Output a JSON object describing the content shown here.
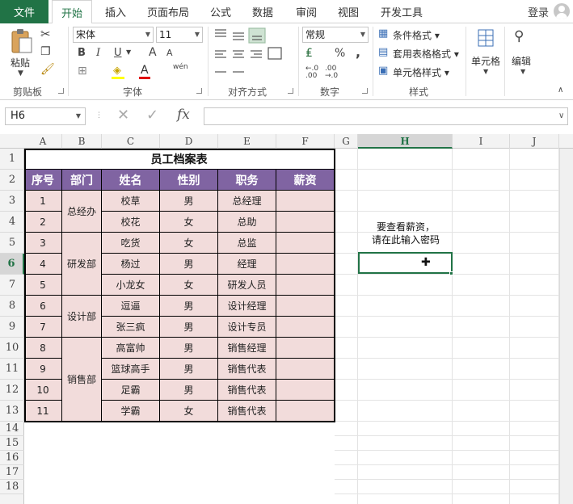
{
  "tabs": {
    "file": "文件",
    "items": [
      "开始",
      "插入",
      "页面布局",
      "公式",
      "数据",
      "审阅",
      "视图",
      "开发工具"
    ],
    "login": "登录"
  },
  "ribbon": {
    "clipboard": {
      "paste": "粘贴",
      "label": "剪贴板"
    },
    "font": {
      "name": "宋体",
      "size": "11",
      "label": "字体",
      "bold": "B",
      "italic": "I",
      "underline": "U",
      "grow": "A",
      "shrink": "A",
      "wen": "wén",
      "font_color": "A"
    },
    "alignment": {
      "label": "对齐方式"
    },
    "number": {
      "format": "常规",
      "label": "数字",
      "percent": "%",
      "comma": ","
    },
    "styles": {
      "conditional": "条件格式",
      "table": "套用表格格式",
      "cell_style": "单元格样式",
      "label": "样式"
    },
    "cells": {
      "label": "单元格"
    },
    "editing": {
      "label": "编辑"
    }
  },
  "formula_bar": {
    "name_box": "H6",
    "fx": "fx",
    "value": ""
  },
  "columns": [
    "A",
    "B",
    "C",
    "D",
    "E",
    "F",
    "G",
    "H",
    "I",
    "J"
  ],
  "active_column": "H",
  "rows": [
    "1",
    "2",
    "3",
    "4",
    "5",
    "6",
    "7",
    "8",
    "9",
    "10",
    "11",
    "12",
    "13",
    "14",
    "15",
    "16",
    "17",
    "18"
  ],
  "active_row": "6",
  "table": {
    "title": "员工档案表",
    "headers": [
      "序号",
      "部门",
      "姓名",
      "性别",
      "职务",
      "薪资"
    ],
    "departments": [
      "总经办",
      "研发部",
      "设计部",
      "销售部"
    ],
    "records": [
      {
        "id": "1",
        "name": "校草",
        "gender": "男",
        "title": "总经理"
      },
      {
        "id": "2",
        "name": "校花",
        "gender": "女",
        "title": "总助"
      },
      {
        "id": "3",
        "name": "吃货",
        "gender": "女",
        "title": "总监"
      },
      {
        "id": "4",
        "name": "杨过",
        "gender": "男",
        "title": "经理"
      },
      {
        "id": "5",
        "name": "小龙女",
        "gender": "女",
        "title": "研发人员"
      },
      {
        "id": "6",
        "name": "逗逼",
        "gender": "男",
        "title": "设计经理"
      },
      {
        "id": "7",
        "name": "张三疯",
        "gender": "男",
        "title": "设计专员"
      },
      {
        "id": "8",
        "name": "高富帅",
        "gender": "男",
        "title": "销售经理"
      },
      {
        "id": "9",
        "name": "篮球高手",
        "gender": "男",
        "title": "销售代表"
      },
      {
        "id": "10",
        "name": "足霸",
        "gender": "男",
        "title": "销售代表"
      },
      {
        "id": "11",
        "name": "学霸",
        "gender": "女",
        "title": "销售代表"
      }
    ]
  },
  "prompt": {
    "line1": "要查看薪资，",
    "line2": "请在此输入密码"
  },
  "colors": {
    "accent": "#217346",
    "header_fill": "#8064a2",
    "row_fill": "#f2dcdb"
  }
}
